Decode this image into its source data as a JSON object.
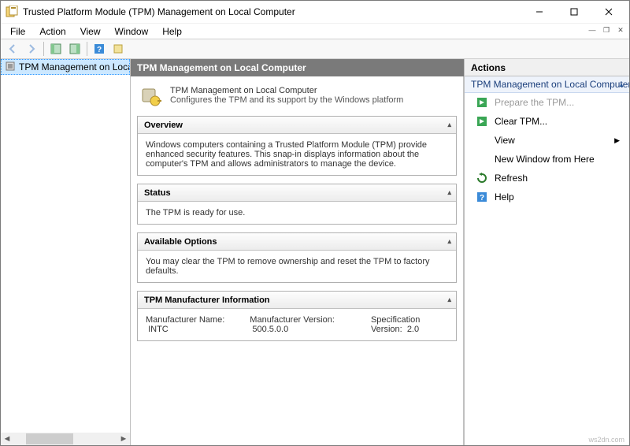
{
  "window": {
    "title": "Trusted Platform Module (TPM) Management on Local Computer"
  },
  "menubar": [
    "File",
    "Action",
    "View",
    "Window",
    "Help"
  ],
  "tree": {
    "selected": "TPM Management on Local Co"
  },
  "center": {
    "header": "TPM Management on Local Computer",
    "intro_title": "TPM Management on Local Computer",
    "intro_sub": "Configures the TPM and its support by the Windows platform",
    "overview_heading": "Overview",
    "overview_body": "Windows computers containing a Trusted Platform Module (TPM) provide enhanced security features. This snap-in displays information about the computer's TPM and allows administrators to manage the device.",
    "status_heading": "Status",
    "status_body": "The TPM is ready for use.",
    "options_heading": "Available Options",
    "options_body": "You may clear the TPM to remove ownership and reset the TPM to factory defaults.",
    "mfr_heading": "TPM Manufacturer Information",
    "mfr_name_label": "Manufacturer Name:",
    "mfr_name_value": "INTC",
    "mfr_ver_label": "Manufacturer Version:",
    "mfr_ver_value": "500.5.0.0",
    "spec_ver_label": "Specification Version:",
    "spec_ver_value": "2.0"
  },
  "actions": {
    "title": "Actions",
    "group": "TPM Management on Local Computer",
    "prepare": "Prepare the TPM...",
    "clear": "Clear TPM...",
    "view": "View",
    "new_window": "New Window from Here",
    "refresh": "Refresh",
    "help": "Help"
  },
  "branding": "ws2dn.com"
}
